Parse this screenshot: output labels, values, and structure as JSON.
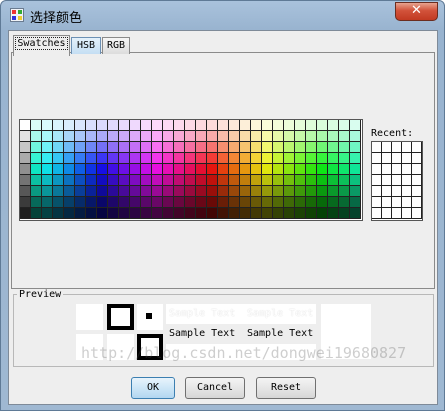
{
  "window": {
    "title": "选择颜色",
    "close_glyph": "✕"
  },
  "tabs": [
    {
      "label": "Swatches",
      "active": true
    },
    {
      "label": "HSB",
      "active": false
    },
    {
      "label": "RGB",
      "active": false
    }
  ],
  "swatches": {
    "recent_label": "Recent:",
    "recent_color": "#ffffff"
  },
  "preview": {
    "title": "Preview",
    "sample_text": "Sample Text",
    "preview_color": "#ffffff"
  },
  "buttons": {
    "ok": "OK",
    "cancel": "Cancel",
    "reset": "Reset"
  },
  "watermark": "http://blog.csdn.net/dongwei19680827"
}
